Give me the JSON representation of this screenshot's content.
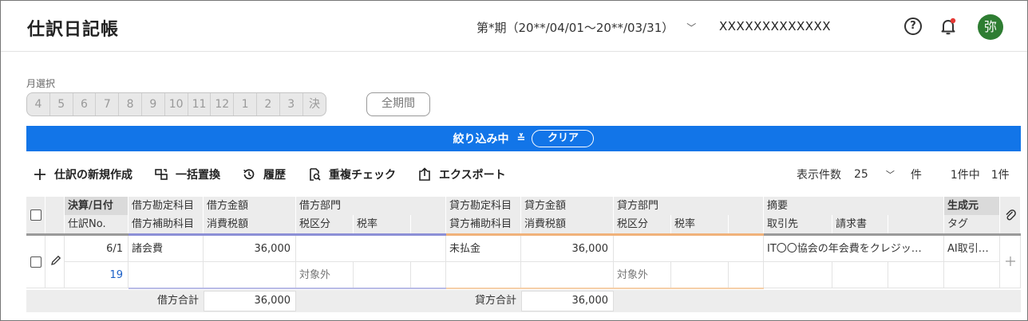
{
  "header": {
    "title": "仕訳日記帳",
    "period": "第*期（20**/04/01〜20**/03/31）",
    "company": "XXXXXXXXXXXXX",
    "avatar": "弥"
  },
  "months": {
    "label": "月選択",
    "items": [
      "4",
      "5",
      "6",
      "7",
      "8",
      "9",
      "10",
      "11",
      "12",
      "1",
      "2",
      "3",
      "決"
    ],
    "all": "全期間"
  },
  "filter": {
    "label": "絞り込み中",
    "clear": "クリア"
  },
  "toolbar": {
    "new": "仕訳の新規作成",
    "replace": "一括置換",
    "history": "履歴",
    "duplicate": "重複チェック",
    "export": "エクスポート"
  },
  "pager": {
    "label": "表示件数",
    "size": "25",
    "unit": "件",
    "range": "1件中",
    "total": "1件"
  },
  "columns": {
    "date": "決算/日付",
    "journal_no": "仕訳No.",
    "debit_account": "借方勘定科目",
    "debit_sub": "借方補助科目",
    "debit_amount": "借方金額",
    "debit_tax": "消費税額",
    "debit_dept": "借方部門",
    "debit_tax_class": "税区分",
    "debit_tax_rate": "税率",
    "credit_account": "貸方勘定科目",
    "credit_sub": "貸方補助科目",
    "credit_amount": "貸方金額",
    "credit_tax": "消費税額",
    "credit_dept": "貸方部門",
    "credit_tax_class": "税区分",
    "credit_tax_rate": "税率",
    "memo": "摘要",
    "partner": "取引先",
    "invoice": "請求書",
    "source": "生成元",
    "tag": "タグ"
  },
  "row": {
    "date": "6/1",
    "journal_no": "19",
    "debit_account": "諸会費",
    "debit_amount": "36,000",
    "debit_tax_class": "対象外",
    "credit_account": "未払金",
    "credit_amount": "36,000",
    "credit_tax_class": "対象外",
    "memo": "IT〇〇協会の年会費をクレジッ…",
    "source": "AI取引…"
  },
  "totals": {
    "debit_label": "借方合計",
    "debit_value": "36,000",
    "credit_label": "貸方合計",
    "credit_value": "36,000"
  },
  "colors": {
    "accent": "#1275e8",
    "debit_line": "#8c8fd6",
    "credit_line": "#f0b27a",
    "avatar_bg": "#2e7d32"
  }
}
